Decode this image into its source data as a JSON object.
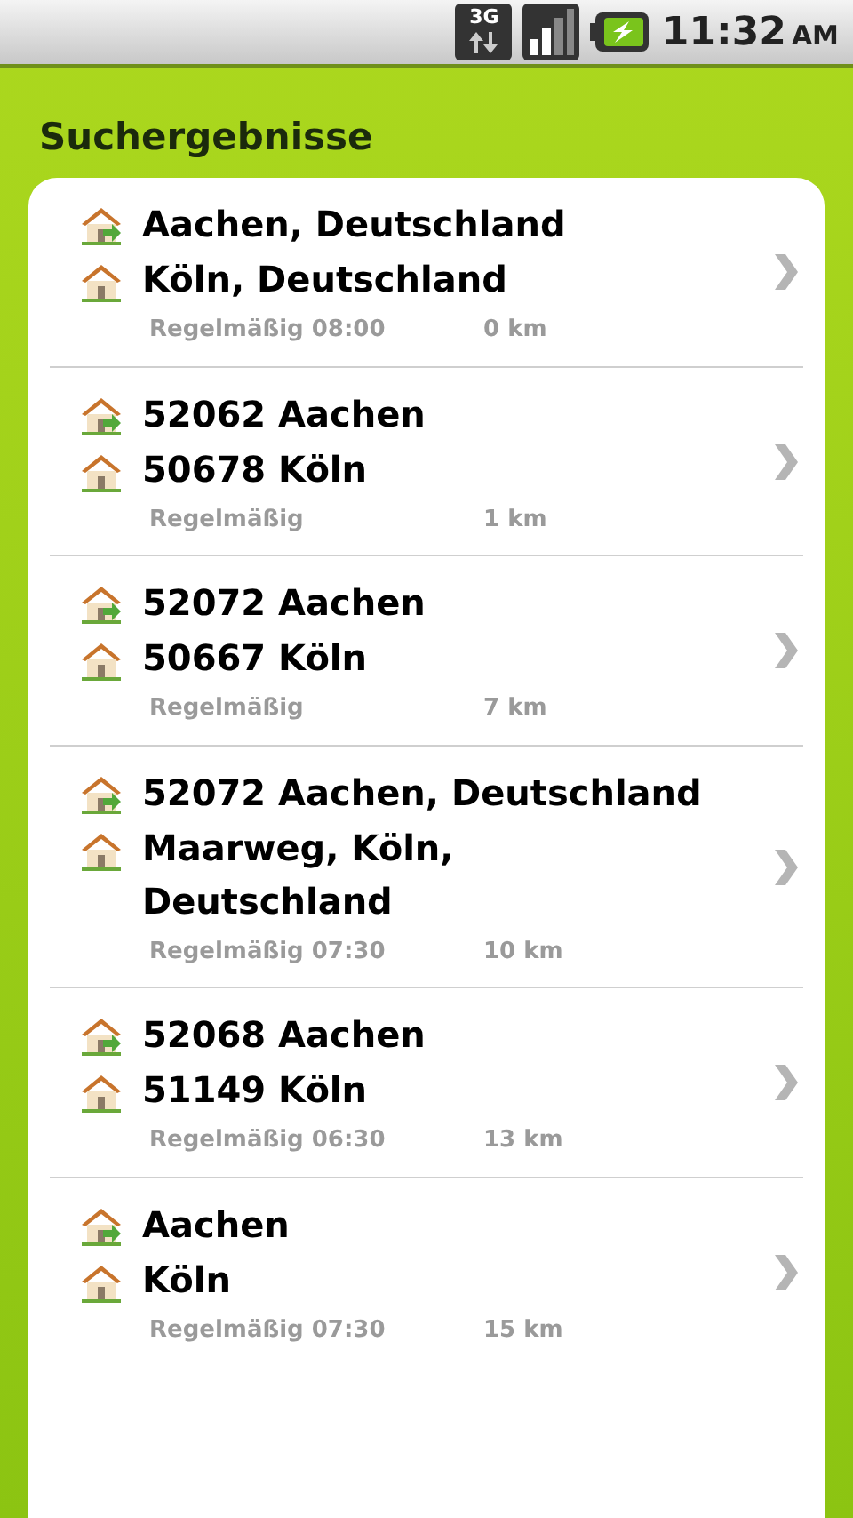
{
  "status_bar": {
    "network": "3G",
    "time": "11:32",
    "ampm": "AM"
  },
  "title": "Suchergebnisse",
  "results": [
    {
      "from": "Aachen, Deutschland",
      "to": "Köln, Deutschland",
      "schedule": "Regelmäßig 08:00",
      "distance": "0 km"
    },
    {
      "from": "52062 Aachen",
      "to": "50678 Köln",
      "schedule": "Regelmäßig",
      "distance": "1 km"
    },
    {
      "from": "52072 Aachen",
      "to": "50667 Köln",
      "schedule": "Regelmäßig",
      "distance": "7 km"
    },
    {
      "from": "52072 Aachen, Deutschland",
      "to": "Maarweg, Köln, Deutschland",
      "schedule": "Regelmäßig 07:30",
      "distance": "10 km"
    },
    {
      "from": "52068 Aachen",
      "to": "51149 Köln",
      "schedule": "Regelmäßig 06:30",
      "distance": "13 km"
    },
    {
      "from": "Aachen",
      "to": "Köln",
      "schedule": "Regelmäßig 07:30",
      "distance": "15 km"
    }
  ]
}
